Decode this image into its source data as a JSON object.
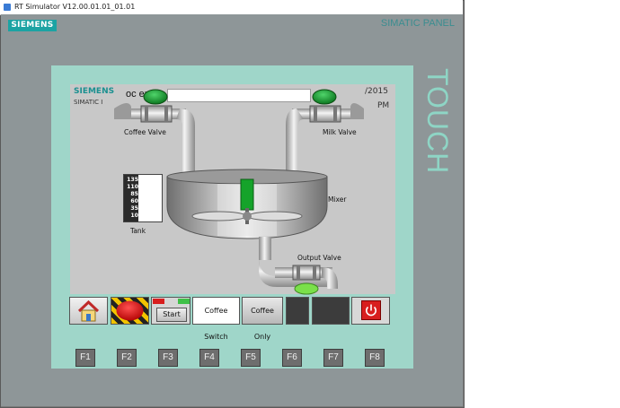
{
  "window": {
    "title": "RT Simulator V12.00.01.01_01.01"
  },
  "device": {
    "brand": "SIEMENS",
    "panel_title": "SIMATIC PANEL",
    "touch_label": "TOUCH"
  },
  "screen": {
    "logo": "SIEMENS",
    "sub": "SIMATIC I",
    "header_text": "oc     en",
    "date": "/2015",
    "time": "PM",
    "labels": {
      "coffee_valve": "Coffee Valve",
      "milk_valve": "Milk Valve",
      "mixer": "Mixer",
      "tank": "Tank",
      "output_valve": "Output Valve"
    },
    "scale_values": [
      "135",
      "110",
      "85",
      "60",
      "35",
      "10"
    ]
  },
  "buttons": {
    "start": "Start",
    "coffee_switch": "Coffee Switch",
    "coffee_only": "Coffee Only"
  },
  "fkeys": [
    "F1",
    "F2",
    "F3",
    "F4",
    "F5",
    "F6",
    "F7",
    "F8"
  ],
  "colors": {
    "status_green": "#0e8a1e",
    "light_green": "#7ae04a",
    "panel_teal": "#9fd6c9",
    "stop_red": "#d81e1e"
  }
}
